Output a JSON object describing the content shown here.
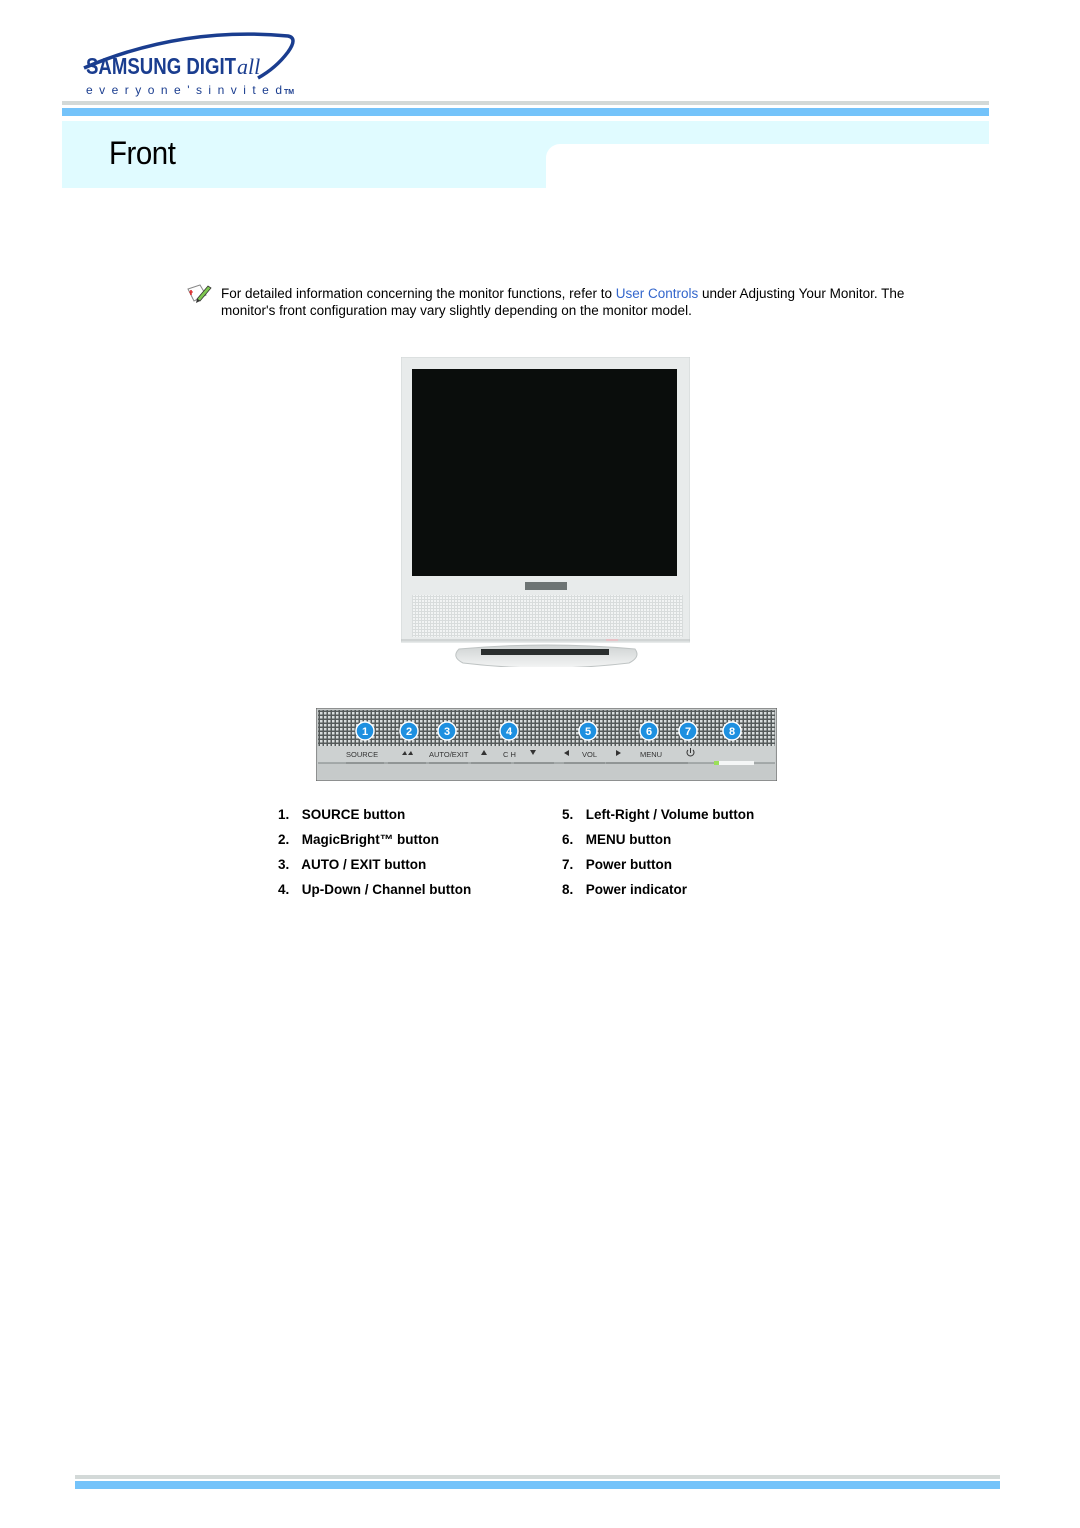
{
  "brand": {
    "name": "SAMSUNG DIGITall",
    "tagline": "everyone's invited™",
    "wordmark_main": "SAMSUNG DIGIT",
    "wordmark_script": "all",
    "tagline_text": "e v e r y o n e ' s   i n v i t e d",
    "tagline_tm": "TM",
    "color": "#1a3d8f"
  },
  "page": {
    "title": "Front"
  },
  "note": {
    "icon": "note-pencil-icon",
    "text_before": "For detailed information concerning the monitor functions, refer to ",
    "link_label": "User Controls",
    "text_after": " under Adjusting Your Monitor. The monitor's front configuration may vary slightly depending on the monitor model."
  },
  "illustration": {
    "monitor_alt": "Monitor front view",
    "panel_labels": {
      "source": "SOURCE",
      "auto_exit": "AUTO/EXIT",
      "ch": "C H",
      "vol": "VOL",
      "menu": "MENU"
    },
    "callouts": [
      "1",
      "2",
      "3",
      "4",
      "5",
      "6",
      "7",
      "8"
    ],
    "callout_color": "#1e90e0",
    "indicator_color": "#9be05a"
  },
  "legend": {
    "left": [
      {
        "num": "1.",
        "label": "SOURCE button"
      },
      {
        "num": "2.",
        "label": "MagicBright™ button"
      },
      {
        "num": "3.",
        "label": "AUTO / EXIT button"
      },
      {
        "num": "4.",
        "label": "Up-Down / Channel button"
      }
    ],
    "right": [
      {
        "num": "5.",
        "label": "Left-Right / Volume button"
      },
      {
        "num": "6.",
        "label": "MENU button"
      },
      {
        "num": "7.",
        "label": "Power button"
      },
      {
        "num": "8.",
        "label": "Power indicator"
      }
    ]
  }
}
